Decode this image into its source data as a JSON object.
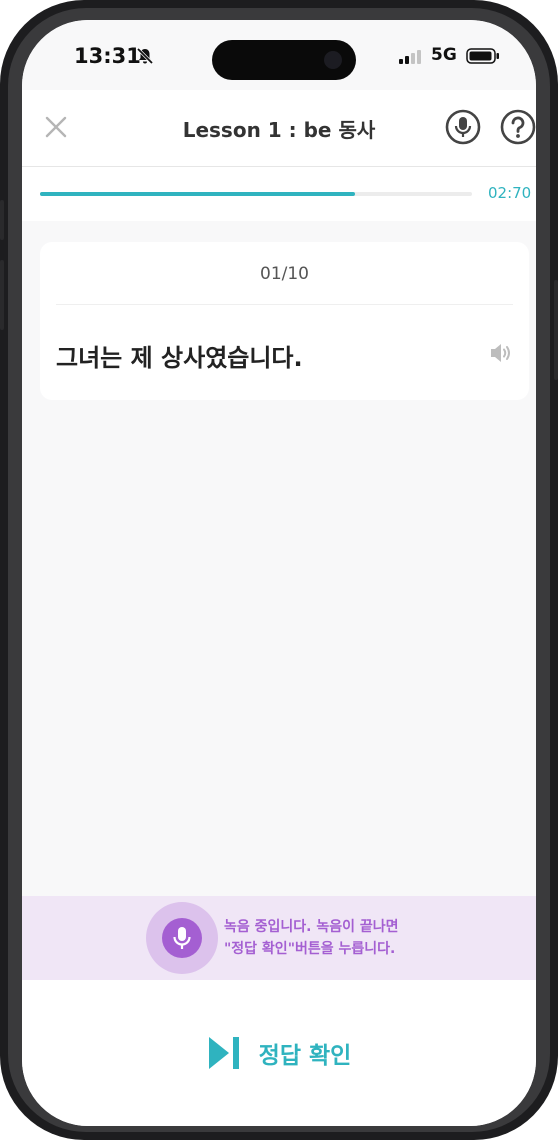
{
  "status_bar": {
    "time": "13:31",
    "network": "5G"
  },
  "header": {
    "title": "Lesson 1 : be 동사"
  },
  "progress": {
    "fraction": 0.73,
    "timer": "02:70"
  },
  "card": {
    "counter": "01/10",
    "sentence": "그녀는 제 상사였습니다."
  },
  "recording": {
    "line1": "녹음 중입니다. 녹음이 끝나면",
    "line2": "\"정답 확인\"버튼을 누릅니다."
  },
  "footer": {
    "check_label": "정답 확인"
  },
  "colors": {
    "accent": "#2fb3bf",
    "record": "#a45fd2",
    "record_bg": "#f0e6f6"
  }
}
